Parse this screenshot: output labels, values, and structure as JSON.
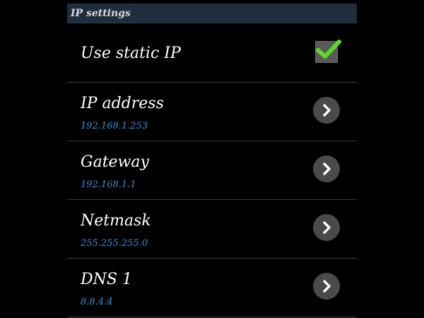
{
  "section": {
    "title": "IP settings"
  },
  "static_ip": {
    "label": "Use static IP",
    "checked": true
  },
  "settings": [
    {
      "id": "ip-address",
      "label": "IP address",
      "value": "192.168.1.253"
    },
    {
      "id": "gateway",
      "label": "Gateway",
      "value": "192.168.1.1"
    },
    {
      "id": "netmask",
      "label": "Netmask",
      "value": "255.255.255.0"
    },
    {
      "id": "dns1",
      "label": "DNS 1",
      "value": "8.8.4.4"
    }
  ],
  "colors": {
    "background": "#000000",
    "header": "#1f2d3d",
    "value_text": "#3b8fd9",
    "check": "#5fd62a",
    "chevron_bg": "#4a4a4a"
  },
  "icons": {
    "checkbox": "check-icon",
    "chevron": "chevron-right-icon"
  }
}
